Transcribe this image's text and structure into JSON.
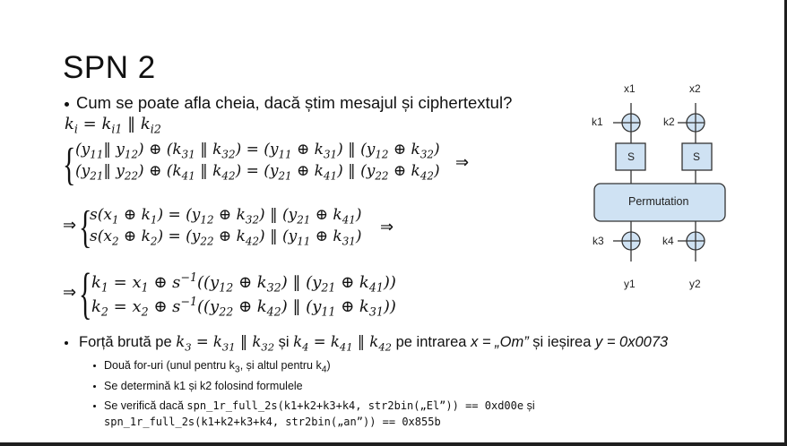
{
  "slide": {
    "title": "SPN 2",
    "question": "Cum se poate afla cheia, dacă știm mesajul și ciphertextul?",
    "key_def": [
      [
        "k",
        "i"
      ],
      [
        " = k",
        "i1"
      ],
      [
        " ‖ k",
        "i2"
      ]
    ],
    "system1": [
      [
        [
          "(y",
          "11"
        ],
        [
          "‖ y",
          "12"
        ],
        [
          ") ⊕ (k",
          "31"
        ],
        [
          " ‖ k",
          "32"
        ],
        [
          ") = (y",
          "11"
        ],
        [
          " ⊕ k",
          "31"
        ],
        [
          ") ‖ (y",
          "12"
        ],
        [
          " ⊕ k",
          "32"
        ],
        [
          ")"
        ]
      ],
      [
        [
          "(y",
          "21"
        ],
        [
          "‖ y",
          "22"
        ],
        [
          ") ⊕ (k",
          "41"
        ],
        [
          " ‖ k",
          "42"
        ],
        [
          ") = (y",
          "21"
        ],
        [
          " ⊕ k",
          "41"
        ],
        [
          ") ‖ (y",
          "22"
        ],
        [
          " ⊕ k",
          "42"
        ],
        [
          ")"
        ]
      ]
    ],
    "system2": [
      [
        [
          "s(x",
          "1"
        ],
        [
          " ⊕ k",
          "1"
        ],
        [
          ") = (y",
          "12"
        ],
        [
          " ⊕ k",
          "32"
        ],
        [
          ") ‖ (y",
          "21"
        ],
        [
          " ⊕ k",
          "41"
        ],
        [
          ")"
        ]
      ],
      [
        [
          "s(x",
          "2"
        ],
        [
          " ⊕ k",
          "2"
        ],
        [
          ") = (y",
          "22"
        ],
        [
          " ⊕ k",
          "42"
        ],
        [
          ") ‖ (y",
          "11"
        ],
        [
          " ⊕ k",
          "31"
        ],
        [
          ")"
        ]
      ]
    ],
    "system3": [
      [
        [
          "k",
          "1"
        ],
        [
          " = x",
          "1"
        ],
        [
          " ⊕ s",
          null,
          "−1"
        ],
        [
          "((y",
          "12"
        ],
        [
          " ⊕ k",
          "32"
        ],
        [
          ") ‖ (y",
          "21"
        ],
        [
          " ⊕ k",
          "41"
        ],
        [
          "))"
        ]
      ],
      [
        [
          "k",
          "2"
        ],
        [
          " = x",
          "2"
        ],
        [
          " ⊕ s",
          null,
          "−1"
        ],
        [
          "((y",
          "22"
        ],
        [
          " ⊕ k",
          "42"
        ],
        [
          ") ‖ (y",
          "11"
        ],
        [
          " ⊕ k",
          "31"
        ],
        [
          "))"
        ]
      ]
    ],
    "implies": "⇒",
    "brace": "{",
    "bullet_brute": [
      {
        "t": "Forță brută pe "
      },
      {
        "m": 1,
        "t": "k",
        "sub": "3"
      },
      {
        "m": 1,
        "t": " = k",
        "sub": "31"
      },
      {
        "m": 1,
        "t": " ‖ k",
        "sub": "32"
      },
      {
        "t": " și "
      },
      {
        "m": 1,
        "t": "k",
        "sub": "4"
      },
      {
        "m": 1,
        "t": " = k",
        "sub": "41"
      },
      {
        "m": 1,
        "t": " ‖ k",
        "sub": "42"
      },
      {
        "t": " pe intrarea "
      },
      {
        "i": 1,
        "t": "x = „Om”"
      },
      {
        "t": " și ieșirea "
      },
      {
        "i": 1,
        "t": "y = 0x0073"
      }
    ],
    "sub_bullets": [
      [
        {
          "t": "Două for-uri (unul pentru k"
        },
        {
          "t": "",
          "sub": "3"
        },
        {
          "t": ", și altul pentru k"
        },
        {
          "t": "",
          "sub": "4"
        },
        {
          "t": ")"
        }
      ],
      [
        {
          "t": "Se determină k1 și k2 folosind formulele"
        }
      ],
      [
        {
          "t": "Se verifică dacă "
        },
        {
          "c": 1,
          "t": "spn_1r_full_2s(k1+k2+k3+k4, str2bin(„El”)) == 0xd00e"
        },
        {
          "t": " și"
        }
      ]
    ],
    "sub_bullet_cont": "spn_1r_full_2s(k1+k2+k3+k4, str2bin(„an”)) == 0x855b"
  },
  "diagram": {
    "inputs": [
      "x1",
      "x2"
    ],
    "keys_top": [
      "k1",
      "k2"
    ],
    "sbox_label": "S",
    "permutation_label": "Permutation",
    "keys_bottom": [
      "k3",
      "k4"
    ],
    "outputs": [
      "y1",
      "y2"
    ],
    "fill_color": "#cfe2f3",
    "stroke_color": "#333333"
  }
}
